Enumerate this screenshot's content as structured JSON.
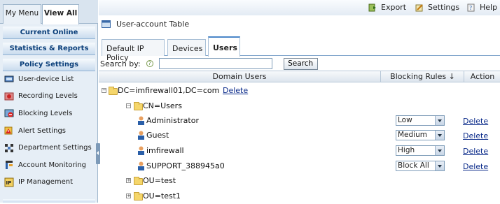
{
  "left_tabs": {
    "my_menu": "My Menu",
    "view_all": "View All"
  },
  "left_sections": {
    "current_online": "Current Online",
    "statistics_reports": "Statistics & Reports",
    "policy_settings": "Policy Settings"
  },
  "nav_items": [
    {
      "label": "User-device List",
      "icon": "user-device-icon"
    },
    {
      "label": "Recording Levels",
      "icon": "recording-icon"
    },
    {
      "label": "Blocking Levels",
      "icon": "blocking-icon"
    },
    {
      "label": "Alert Settings",
      "icon": "alert-icon"
    },
    {
      "label": "Department Settings",
      "icon": "department-icon"
    },
    {
      "label": "Account Monitoring",
      "icon": "monitoring-icon"
    },
    {
      "label": "IP Management",
      "icon": "ip-icon"
    }
  ],
  "toolbar": {
    "export": "Export",
    "settings": "Settings",
    "help": "Help"
  },
  "title": "User-account Table",
  "tabs": [
    "Default IP Policy",
    "Devices",
    "Users"
  ],
  "search": {
    "label": "Search by:",
    "help": "?",
    "value": "",
    "button": "Search"
  },
  "table_headers": {
    "domain_users": "Domain Users",
    "blocking_rules": "Blocking Rules ↓",
    "action": "Action"
  },
  "tree": {
    "root_label": "DC=imfirewall01,DC=com",
    "root_delete": "Delete",
    "cn_users": "CN=Users",
    "users": [
      {
        "name": "Administrator",
        "rule": "Low",
        "action": "Delete"
      },
      {
        "name": "Guest",
        "rule": "Medium",
        "action": "Delete"
      },
      {
        "name": "imfirewall",
        "rule": "High",
        "action": "Delete"
      },
      {
        "name": "SUPPORT_388945a0",
        "rule": "Block All",
        "action": "Delete"
      }
    ],
    "ou_test": "OU=test",
    "ou_test1": "OU=test1"
  },
  "colors": {
    "accent": "#4a86c8",
    "header_text": "#0b3f7a",
    "link": "#0a2a8a"
  }
}
